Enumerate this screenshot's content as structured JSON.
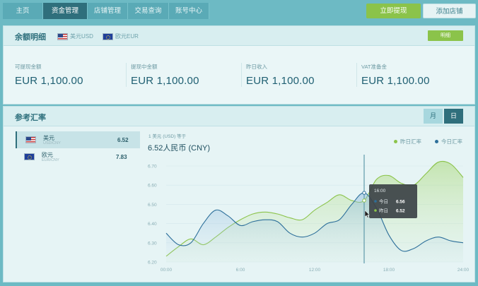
{
  "nav": {
    "tabs": [
      "主页",
      "资金管理",
      "店铺管理",
      "交易查询",
      "账号中心"
    ],
    "active_index": 1,
    "withdraw_label": "立即提现",
    "add_shop_label": "添加店铺"
  },
  "balance": {
    "title": "余额明细",
    "currencies": [
      "美元USD",
      "欧元EUR"
    ],
    "detail_button": "明细",
    "stats": [
      {
        "label": "可提现金额",
        "value": "EUR 1,100.00"
      },
      {
        "label": "提现中金额",
        "value": "EUR 1,100.00"
      },
      {
        "label": "昨日收入",
        "value": "EUR 1,100.00"
      },
      {
        "label": "VAT准备金",
        "value": "EUR 1,100.00"
      }
    ]
  },
  "rates": {
    "title": "参考汇率",
    "toggle": {
      "month": "月",
      "day": "日",
      "selected": "day"
    },
    "currencies": [
      {
        "name": "美元",
        "pair": "USD/CNY",
        "rate": "6.52",
        "flag": "us-flag",
        "selected": true
      },
      {
        "name": "欧元",
        "pair": "EUR/CNY",
        "rate": "7.83",
        "flag": "eu-flag",
        "selected": false
      }
    ],
    "subtitle": "1 美元 (USD) 等于",
    "headline": "6.52人民币 (CNY)",
    "legend": {
      "yesterday": "昨日汇率",
      "today": "今日汇率"
    },
    "colors": {
      "yesterday": "#8bc34a",
      "today": "#2d6f9a"
    }
  },
  "chart_data": {
    "type": "line",
    "x": [
      0,
      1,
      2,
      3,
      4,
      5,
      6,
      7,
      8,
      9,
      10,
      11,
      12,
      13,
      14,
      15,
      16,
      17,
      18,
      19,
      20,
      21,
      22,
      23,
      24
    ],
    "x_ticks": [
      0,
      6,
      12,
      18,
      24
    ],
    "x_tick_labels": [
      "00:00",
      "6:00",
      "12:00",
      "18:00",
      "24:00"
    ],
    "ylim": [
      6.2,
      6.7
    ],
    "y_ticks": [
      6.2,
      6.3,
      6.4,
      6.5,
      6.6,
      6.7
    ],
    "y_tick_labels": [
      "6.20",
      "6.30",
      "6.40",
      "6.50",
      "6.60",
      "6.70"
    ],
    "series": [
      {
        "name": "今日汇率",
        "values": [
          6.35,
          6.29,
          6.3,
          6.4,
          6.47,
          6.44,
          6.39,
          6.41,
          6.42,
          6.41,
          6.35,
          6.33,
          6.35,
          6.4,
          6.42,
          6.5,
          6.56,
          6.48,
          6.34,
          6.26,
          6.27,
          6.31,
          6.33,
          6.31,
          6.3
        ]
      },
      {
        "name": "昨日汇率",
        "values": [
          6.23,
          6.28,
          6.32,
          6.29,
          6.33,
          6.38,
          6.42,
          6.45,
          6.46,
          6.45,
          6.43,
          6.42,
          6.47,
          6.51,
          6.55,
          6.52,
          6.52,
          6.63,
          6.65,
          6.61,
          6.6,
          6.66,
          6.72,
          6.71,
          6.64
        ]
      }
    ],
    "tooltip": {
      "time": "16:00",
      "today_label": "今日",
      "today_value": "6.56",
      "yesterday_label": "昨日",
      "yesterday_value": "6.52",
      "x": 16
    }
  }
}
